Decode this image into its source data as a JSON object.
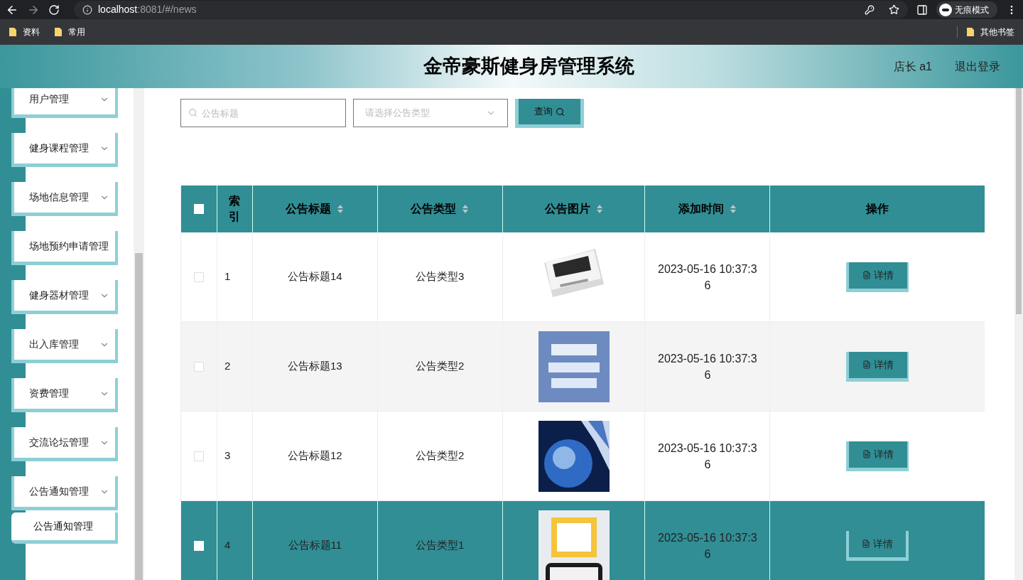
{
  "browser": {
    "url_host": "localhost",
    "url_rest": ":8081/#/news",
    "incognito_label": "无痕模式",
    "bookmarks": [
      "资料",
      "常用"
    ],
    "other_bookmarks": "其他书签"
  },
  "header": {
    "title": "金帝豪斯健身房管理系统",
    "user": "店长 a1",
    "logout": "退出登录"
  },
  "sidebar": {
    "items": [
      {
        "label": "用户管理",
        "expandable": true
      },
      {
        "label": "健身课程管理",
        "expandable": true
      },
      {
        "label": "场地信息管理",
        "expandable": true
      },
      {
        "label": "场地预约申请管理",
        "expandable": false
      },
      {
        "label": "健身器材管理",
        "expandable": true
      },
      {
        "label": "出入库管理",
        "expandable": true
      },
      {
        "label": "资费管理",
        "expandable": true
      },
      {
        "label": "交流论坛管理",
        "expandable": true
      },
      {
        "label": "公告通知管理",
        "expandable": true,
        "children": [
          {
            "label": "公告通知管理",
            "selected": true
          }
        ]
      }
    ]
  },
  "search": {
    "title_placeholder": "公告标题",
    "type_placeholder": "请选择公告类型",
    "button": "查询"
  },
  "table": {
    "all_checked": false,
    "columns": [
      {
        "label": "索引",
        "sortable": false
      },
      {
        "label": "公告标题",
        "sortable": true
      },
      {
        "label": "公告类型",
        "sortable": true
      },
      {
        "label": "公告图片",
        "sortable": true
      },
      {
        "label": "添加时间",
        "sortable": true
      },
      {
        "label": "操作",
        "sortable": false
      }
    ],
    "rows": [
      {
        "index": "1",
        "title": "公告标题14",
        "type": "公告类型3",
        "time": "2023-05-16 10:37:36",
        "action": "详情",
        "checked": false,
        "selected": false
      },
      {
        "index": "2",
        "title": "公告标题13",
        "type": "公告类型2",
        "time": "2023-05-16 10:37:36",
        "action": "详情",
        "checked": false,
        "selected": false
      },
      {
        "index": "3",
        "title": "公告标题12",
        "type": "公告类型2",
        "time": "2023-05-16 10:37:36",
        "action": "详情",
        "checked": false,
        "selected": false
      },
      {
        "index": "4",
        "title": "公告标题11",
        "type": "公告类型1",
        "time": "2023-05-16 10:37:36",
        "action": "详情",
        "checked": false,
        "selected": true
      }
    ]
  }
}
